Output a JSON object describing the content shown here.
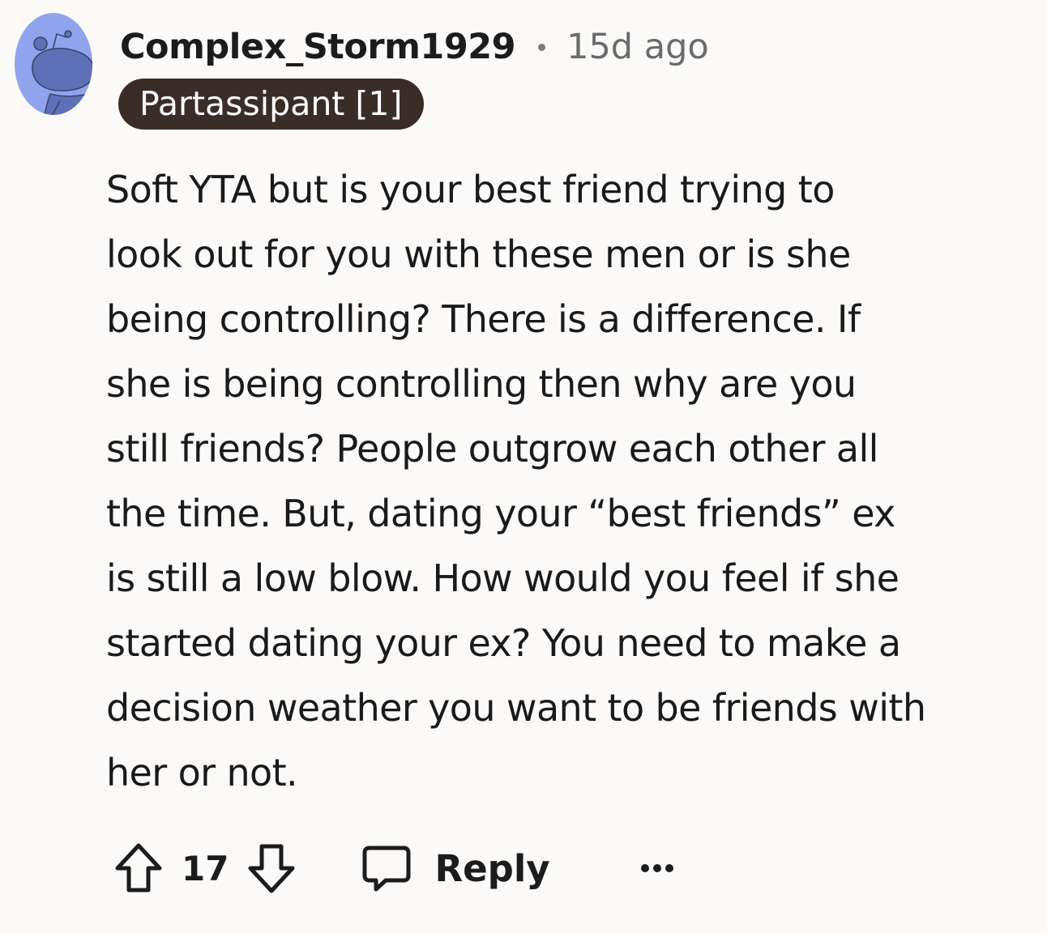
{
  "comment": {
    "author": "Complex_Storm1929",
    "age": "15d ago",
    "flair": "Partassipant [1]",
    "body_lines": [
      "Soft YTA but is your best friend trying to",
      "look out for you with these men or is she",
      "being controlling? There is a difference. If",
      "she is being controlling then why are you",
      "still friends? People outgrow each other all",
      "the time. But, dating your “best friends” ex",
      "is still a low blow. How would you feel if she",
      "started dating your ex? You need to make a",
      "decision weather you want to be friends with",
      "her or not."
    ],
    "score": "17",
    "reply_label": "Reply"
  },
  "icons": {
    "avatar": "snoo-avatar-icon",
    "upvote": "upvote-arrow-icon",
    "downvote": "downvote-arrow-icon",
    "reply": "speech-bubble-icon",
    "more": "more-options-icon"
  },
  "colors": {
    "background": "#fbfaf8",
    "avatar_bg": "#8fa4ec",
    "avatar_figure": "#5e71b6",
    "flair_bg": "#3a2d28",
    "flair_text": "#ffffff",
    "muted_text": "#6b6b6b"
  }
}
